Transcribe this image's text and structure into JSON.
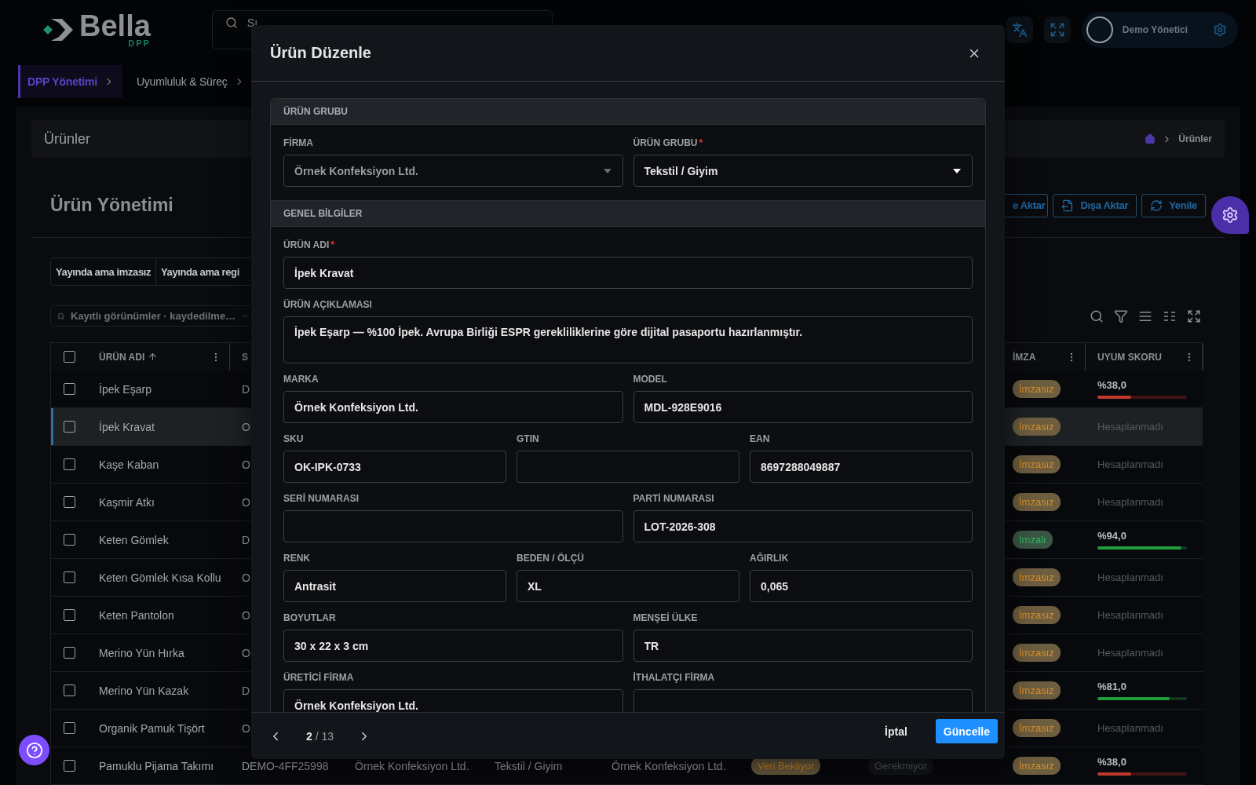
{
  "header": {
    "logo": {
      "name": "Bella",
      "sub": "DPP"
    },
    "search": {
      "placeholder": "Sı"
    },
    "user": {
      "name": "Demo Yönetici"
    }
  },
  "nav": [
    {
      "label": "DPP Yönetimi",
      "selected": true
    },
    {
      "label": "Uyumluluk & Süreç",
      "selected": false
    }
  ],
  "page": {
    "card_title": "Ürünler",
    "breadcrumb": "Ürünler",
    "title": "Ürün Yönetimi",
    "actions": [
      {
        "label": "e Aktar",
        "kind": "import"
      },
      {
        "label": "Dışa Aktar",
        "kind": "export"
      },
      {
        "label": "Yenile",
        "kind": "refresh"
      }
    ],
    "filters": [
      {
        "label": "Yayında ama imzasız"
      },
      {
        "label": "Yayında ama regi"
      }
    ],
    "saved_views": {
      "placeholder": "Kayıtlı görünümler · kaydedilme…"
    }
  },
  "table": {
    "header_checked": false,
    "columns": [
      {
        "label": "ÜRÜN ADI",
        "sorted": true
      },
      {
        "label": "S"
      },
      {
        "label": "İMZA",
        "sorted": false
      },
      {
        "label": "UYUM SKORU",
        "sorted": false
      }
    ],
    "rows": [
      {
        "name": "İpek Eşarp",
        "column_2": "D",
        "checked": false,
        "selected": false,
        "signature": {
          "text": "İmzasız",
          "signed": false
        },
        "score": {
          "text": "%38,0",
          "level": 0.38
        }
      },
      {
        "name": "İpek Kravat",
        "column_2": "O",
        "checked": false,
        "selected": true,
        "signature": {
          "text": "İmzasız",
          "signed": false
        },
        "score": {
          "text": "Hesaplanmadı"
        }
      },
      {
        "name": "Kaşe Kaban",
        "column_2": "O",
        "checked": false,
        "selected": false,
        "signature": {
          "text": "İmzasız",
          "signed": false
        },
        "score": {
          "text": "Hesaplanmadı"
        }
      },
      {
        "name": "Kaşmir Atkı",
        "column_2": "O",
        "checked": false,
        "selected": false,
        "signature": {
          "text": "İmzasız",
          "signed": false
        },
        "score": {
          "text": "Hesaplanmadı"
        }
      },
      {
        "name": "Keten Gömlek",
        "column_2": "D",
        "checked": false,
        "selected": false,
        "signature": {
          "text": "İmzalı",
          "signed": true
        },
        "score": {
          "text": "%94,0",
          "level": 0.94
        }
      },
      {
        "name": "Keten Gömlek Kısa Kollu",
        "column_2": "O",
        "checked": false,
        "selected": false,
        "signature": {
          "text": "İmzasız",
          "signed": false
        },
        "score": {
          "text": "Hesaplanmadı"
        }
      },
      {
        "name": "Keten Pantolon",
        "column_2": "O",
        "checked": false,
        "selected": false,
        "signature": {
          "text": "İmzasız",
          "signed": false
        },
        "score": {
          "text": "Hesaplanmadı"
        }
      },
      {
        "name": "Merino Yün Hırka",
        "column_2": "O",
        "checked": false,
        "selected": false,
        "signature": {
          "text": "İmzasız",
          "signed": false
        },
        "score": {
          "text": "Hesaplanmadı"
        }
      },
      {
        "name": "Merino Yün Kazak",
        "column_2": "D",
        "checked": false,
        "selected": false,
        "signature": {
          "text": "İmzasız",
          "signed": false
        },
        "score": {
          "text": "%81,0",
          "level": 0.81
        }
      },
      {
        "name": "Organik Pamuk Tişört",
        "column_2": "O",
        "checked": false,
        "selected": false,
        "signature": {
          "text": "İmzasız",
          "signed": false
        },
        "score": {
          "text": "Hesaplanmadı"
        }
      },
      {
        "name": "Pamuklu Pijama Takımı",
        "column_2": "DEMO-4FF25998",
        "column_3": "Örnek Konfeksiyon Ltd.",
        "column_4": "Tekstil / Giyim",
        "column_5": "Örnek Konfeksiyon Ltd.",
        "column_6": "Veri Bekliyor",
        "column_7": "Gerekmiyor",
        "checked": false,
        "selected": false,
        "signature": {
          "text": "İmzasız",
          "signed": false
        },
        "score": {
          "text": "%38,0",
          "level": 0.38
        }
      }
    ]
  },
  "modal": {
    "title": "Ürün Düzenle",
    "sections": [
      {
        "title": "ÜRÜN GRUBU",
        "rows": [
          {
            "fields": [
              {
                "label": "FİRMA",
                "kind": "select",
                "value": "Örnek Konfeksiyon Ltd.",
                "disabled": true
              },
              {
                "label": "ÜRÜN GRUBU",
                "mark": "*",
                "kind": "select",
                "value": "Tekstil / Giyim",
                "disabled": false
              }
            ]
          }
        ]
      },
      {
        "title": "GENEL BİLGİLER",
        "rows": [
          {
            "fields": [
              {
                "label": "ÜRÜN ADI",
                "mark": "*",
                "kind": "input",
                "value": "İpek Kravat"
              }
            ]
          },
          {
            "fields": [
              {
                "label": "ÜRÜN AÇIKLAMASI",
                "kind": "textarea",
                "value": "İpek Eşarp — %100 İpek. Avrupa Birliği ESPR gerekliliklerine göre dijital pasaportu hazırlanmıştır."
              }
            ]
          },
          {
            "fields": [
              {
                "label": "MARKA",
                "kind": "input",
                "value": "Örnek Konfeksiyon Ltd."
              },
              {
                "label": "MODEL",
                "kind": "input",
                "value": "MDL-928E9016"
              }
            ]
          },
          {
            "fields": [
              {
                "label": "SKU",
                "kind": "input",
                "value": "OK-IPK-0733"
              },
              {
                "label": "GTIN",
                "kind": "input"
              },
              {
                "label": "EAN",
                "kind": "input",
                "value": "8697288049887"
              }
            ]
          },
          {
            "fields": [
              {
                "label": "SERİ NUMARASI",
                "kind": "input"
              },
              {
                "label": "PARTİ NUMARASI",
                "kind": "input",
                "value": "LOT-2026-308"
              }
            ]
          },
          {
            "fields": [
              {
                "label": "RENK",
                "kind": "input",
                "value": "Antrasit"
              },
              {
                "label": "BEDEN / ÖLÇÜ",
                "kind": "input",
                "value": "XL"
              },
              {
                "label": "AĞIRLIK",
                "kind": "input",
                "value": "0,065"
              }
            ]
          },
          {
            "fields": [
              {
                "label": "BOYUTLAR",
                "kind": "input",
                "value": "30 x 22 x 3 cm"
              },
              {
                "label": "MENŞEİ ÜLKE",
                "kind": "input",
                "value": "TR"
              }
            ]
          },
          {
            "fields": [
              {
                "label": "ÜRETİCİ FİRMA",
                "kind": "input",
                "value": "Örnek Konfeksiyon Ltd."
              },
              {
                "label": "İTHALATÇI FİRMA",
                "kind": "input"
              }
            ]
          }
        ]
      }
    ],
    "pager": {
      "current": "2",
      "rest": "/ 13"
    },
    "buttons": [
      {
        "label": "İptal",
        "kind": "text"
      },
      {
        "label": "Güncelle",
        "kind": "primary"
      }
    ]
  }
}
